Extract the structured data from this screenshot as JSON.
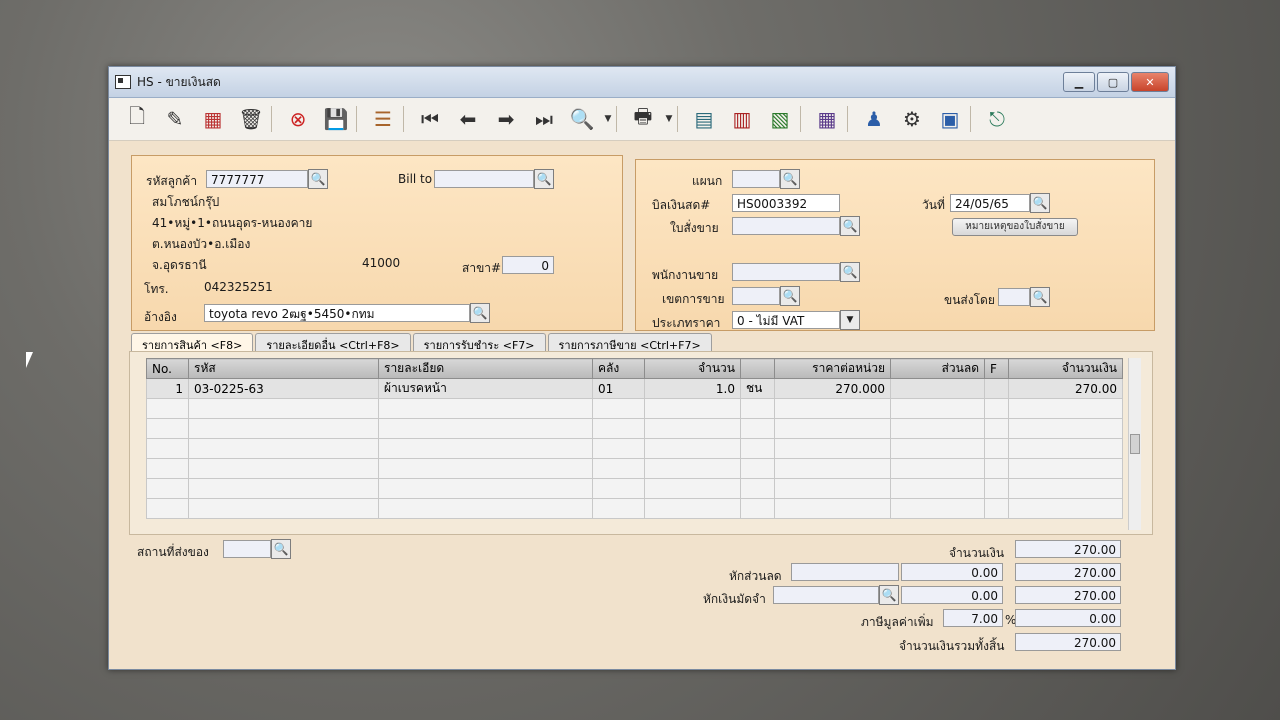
{
  "window": {
    "title": "HS - ขายเงินสด"
  },
  "customer": {
    "code_label": "รหัสลูกค้า",
    "code": "7777777",
    "billto_label": "Bill to",
    "name": "สมโภชน์กรุ๊ป",
    "addr1": "41•หมู่•1•ถนนอุดร-หนองคาย",
    "addr2": "ต.หนองบัว•อ.เมือง",
    "addr3": "จ.อุดรธานี",
    "zip": "41000",
    "branch_label": "สาขา#",
    "branch": "0",
    "phone_label": "โทร.",
    "phone": "042325251",
    "ref_label": "อ้างอิง",
    "ref": "toyota revo 2ฒฐ•5450•กทม"
  },
  "doc": {
    "dept_label": "แผนก",
    "cashbill_label": "บิลเงินสด#",
    "cashbill": "HS0003392",
    "date_label": "วันที่",
    "date": "24/05/65",
    "so_label": "ใบสั่งขาย",
    "note_button": "หมายเหตุของใบสั่งขาย",
    "sales_label": "พนักงานขาย",
    "area_label": "เขตการขาย",
    "ship_label": "ขนส่งโดย",
    "pricetype_label": "ประเภทราคา",
    "pricetype": "0 - ไม่มี VAT"
  },
  "tabs": [
    {
      "label": "รายการสินค้า <F8>"
    },
    {
      "label": "รายละเอียดอื่น <Ctrl+F8>"
    },
    {
      "label": "รายการรับชำระ <F7>"
    },
    {
      "label": "รายการภาษีขาย <Ctrl+F7>"
    }
  ],
  "grid": {
    "headers": [
      "No.",
      "รหัส",
      "รายละเอียด",
      "คลัง",
      "จำนวน",
      "",
      "ราคาต่อหน่วย",
      "ส่วนลด",
      "F",
      "จำนวนเงิน"
    ],
    "row1": {
      "no": "1",
      "code": "03-0225-63",
      "desc": "ผ้าเบรคหน้า",
      "wh": "01",
      "qty": "1.0",
      "unit": "ชน",
      "price": "270.000",
      "disc": "",
      "f": "",
      "amount": "270.00"
    }
  },
  "footer": {
    "shipto_label": "สถานที่ส่งของ",
    "amount_label": "จำนวนเงิน",
    "amount": "270.00",
    "discount_label": "หักส่วนลด",
    "discount": "0.00",
    "after_discount": "270.00",
    "deposit_label": "หักเงินมัดจำ",
    "deposit": "0.00",
    "after_deposit": "270.00",
    "vat_label": "ภาษีมูลค่าเพิ่ม",
    "vat_rate": "7.00",
    "vat_pct": "%",
    "vat_amount": "0.00",
    "total_label": "จำนวนเงินรวมทั้งสิ้น",
    "total": "270.00"
  },
  "icons": {
    "search": "🔍",
    "dropdown": "▼"
  }
}
